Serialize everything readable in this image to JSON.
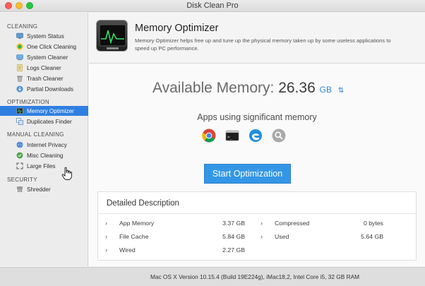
{
  "window": {
    "title": "Disk Clean Pro"
  },
  "sidebar": {
    "sections": [
      {
        "label": "CLEANING"
      },
      {
        "label": "OPTIMIZATION"
      },
      {
        "label": "MANUAL CLEANING"
      },
      {
        "label": "SECURITY"
      }
    ],
    "items": [
      {
        "label": "System Status",
        "icon": "system-status-icon"
      },
      {
        "label": "One Click Cleaning",
        "icon": "one-click-cleaning-icon"
      },
      {
        "label": "System Cleaner",
        "icon": "system-cleaner-icon"
      },
      {
        "label": "Logs Cleaner",
        "icon": "logs-cleaner-icon"
      },
      {
        "label": "Trash Cleaner",
        "icon": "trash-icon"
      },
      {
        "label": "Partial Downloads",
        "icon": "partial-downloads-icon"
      },
      {
        "label": "Memory Optimizer",
        "icon": "memory-optimizer-icon",
        "selected": true
      },
      {
        "label": "Duplicates Finder",
        "icon": "duplicates-finder-icon"
      },
      {
        "label": "Internet Privacy",
        "icon": "globe-icon"
      },
      {
        "label": "Misc Cleaning",
        "icon": "misc-cleaning-icon"
      },
      {
        "label": "Large Files",
        "icon": "large-files-icon"
      },
      {
        "label": "Shredder",
        "icon": "shredder-icon"
      }
    ]
  },
  "header": {
    "title": "Memory Optimizer",
    "description": "Memory Optimizer helps free up and tune up the physical memory taken up by some useless applications to speed up PC performance."
  },
  "memory": {
    "label": "Available Memory:",
    "value": "26.36",
    "unit": "GB"
  },
  "apps": {
    "label": "Apps using significant memory",
    "icons": [
      "chrome-icon",
      "terminal-icon",
      "edge-icon",
      "spotlight-search-icon"
    ]
  },
  "start_button": {
    "label": "Start Optimization"
  },
  "details": {
    "title": "Detailed Description",
    "left": [
      {
        "label": "App Memory",
        "value": "3.37 GB"
      },
      {
        "label": "File Cache",
        "value": "5.84 GB"
      },
      {
        "label": "Wired",
        "value": "2.27 GB"
      }
    ],
    "right": [
      {
        "label": "Compressed",
        "value": "0 bytes"
      },
      {
        "label": "Used",
        "value": "5.64 GB"
      }
    ]
  },
  "status": {
    "text": "Mac OS X Version 10.15.4 (Build 19E224g), iMac18,2, Intel Core i5, 32 GB RAM"
  },
  "colors": {
    "accent": "#2f7fe1",
    "button": "#3496e6",
    "unit": "#2f86d8"
  }
}
